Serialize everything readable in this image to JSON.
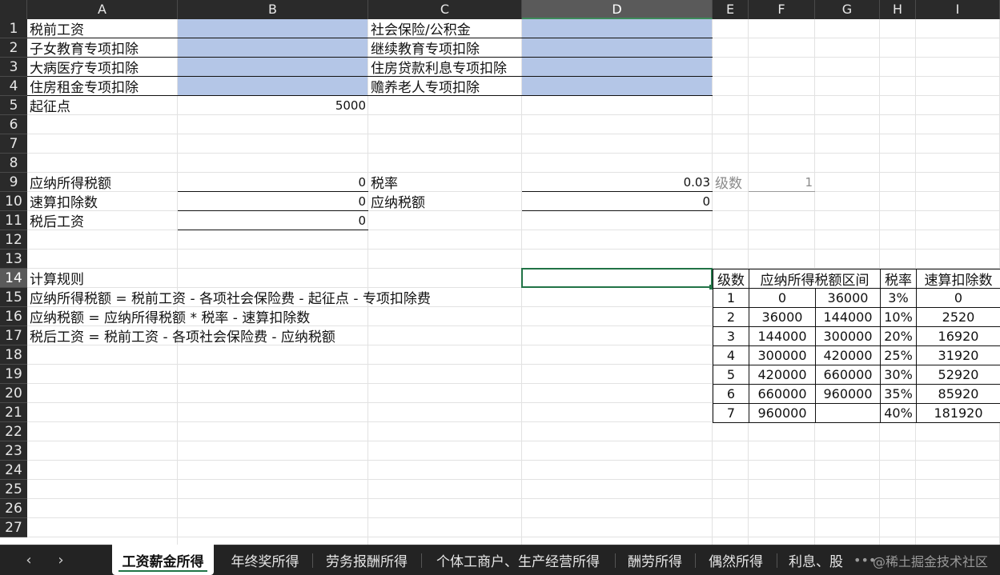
{
  "columns": [
    "A",
    "B",
    "C",
    "D",
    "E",
    "F",
    "G",
    "H",
    "I"
  ],
  "selected_column": "D",
  "rows": [
    "1",
    "2",
    "3",
    "4",
    "5",
    "6",
    "7",
    "8",
    "9",
    "10",
    "11",
    "12",
    "13",
    "14",
    "15",
    "16",
    "17",
    "18",
    "19",
    "20",
    "21",
    "22",
    "23",
    "24",
    "25",
    "26",
    "27"
  ],
  "selected_row": "14",
  "cells": {
    "A1": "税前工资",
    "C1": "社会保险/公积金",
    "A2": "子女教育专项扣除",
    "C2": "继续教育专项扣除",
    "A3": "大病医疗专项扣除",
    "C3": "住房贷款利息专项扣除",
    "A4": "住房租金专项扣除",
    "C4": "赡养老人专项扣除",
    "A5": "起征点",
    "B5": "5000",
    "A9": "应纳所得税额",
    "B9": "0",
    "C9": "税率",
    "D9": "0.03",
    "E9": "级数",
    "F9": "1",
    "A10": "速算扣除数",
    "B10": "0",
    "C10": "应纳税额",
    "D10": "0",
    "A11": "税后工资",
    "B11": "0",
    "A14": "计算规则",
    "A15": "应纳所得税额 = 税前工资 - 各项社会保险费 - 起征点 - 专项扣除费",
    "A16": "应纳税额 = 应纳所得税额 * 税率 - 速算扣除数",
    "A17": "税后工资 = 税前工资 - 各项社会保险费 - 应纳税额"
  },
  "tax_table": {
    "headers": [
      "级数",
      "应纳所得税额区间",
      "税率",
      "速算扣除数"
    ],
    "rows": [
      [
        "1",
        "0",
        "36000",
        "3%",
        "0"
      ],
      [
        "2",
        "36000",
        "144000",
        "10%",
        "2520"
      ],
      [
        "3",
        "144000",
        "300000",
        "20%",
        "16920"
      ],
      [
        "4",
        "300000",
        "420000",
        "25%",
        "31920"
      ],
      [
        "5",
        "420000",
        "660000",
        "30%",
        "52920"
      ],
      [
        "6",
        "660000",
        "960000",
        "35%",
        "85920"
      ],
      [
        "7",
        "960000",
        "",
        "40%",
        "181920"
      ]
    ]
  },
  "sheet_tabs": {
    "prev_icon": "‹",
    "next_icon": "›",
    "tabs": [
      "工资薪金所得",
      "年终奖所得",
      "劳务报酬所得",
      "个体工商户、生产经营所得",
      "酬劳所得",
      "偶然所得",
      "利息、股"
    ],
    "active_index": 0,
    "more_icon": "•••",
    "watermark": "@稀土掘金技术社区"
  },
  "colors": {
    "input_fill": "#b4c6e7",
    "selection": "#217346",
    "header_bg": "#2a2a2a",
    "tab_bar_bg": "#232323"
  }
}
